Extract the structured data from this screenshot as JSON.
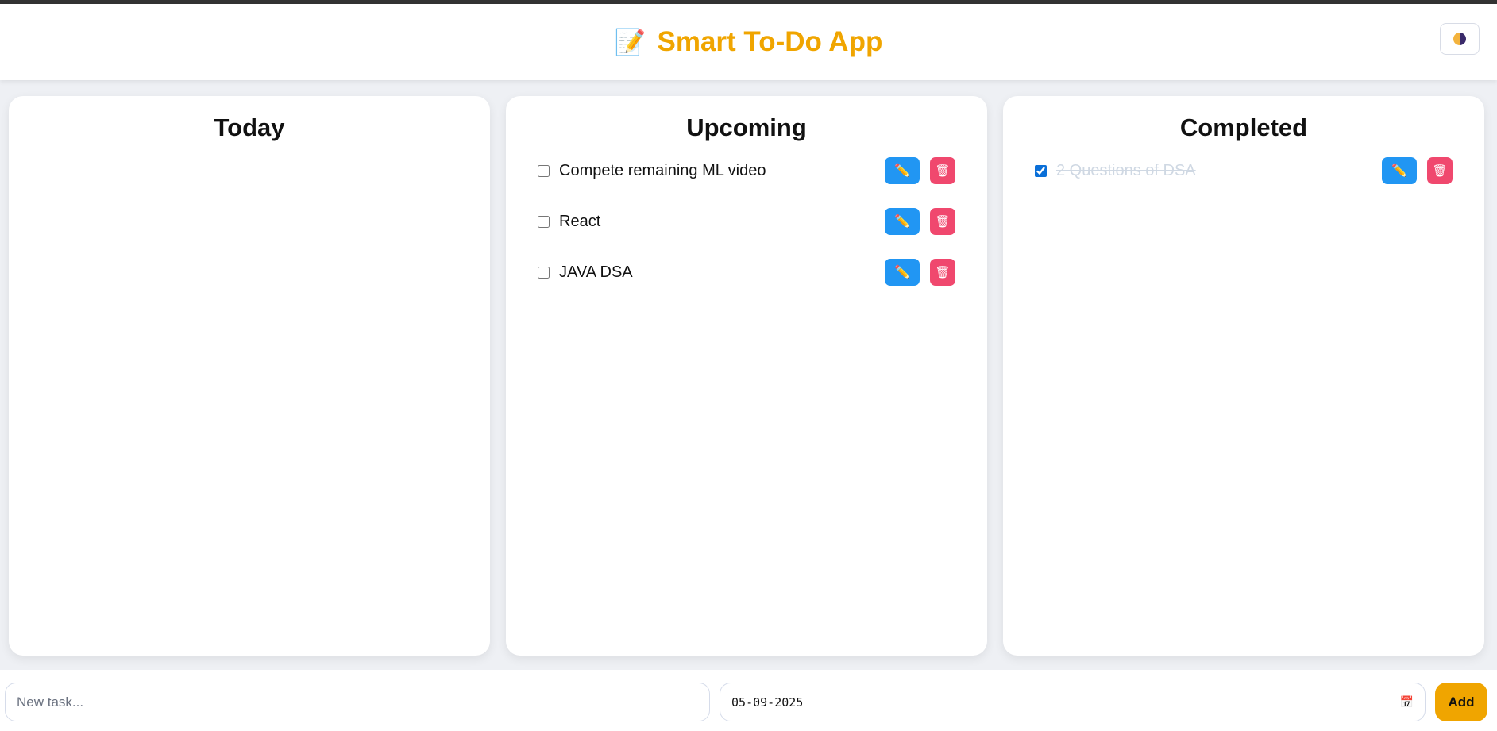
{
  "header": {
    "icon": "memo-icon",
    "title": "Smart To-Do App",
    "theme_toggle_icon": "half-moon-icon"
  },
  "columns": [
    {
      "title": "Today",
      "tasks": []
    },
    {
      "title": "Upcoming",
      "tasks": [
        {
          "text": "Compete remaining ML video",
          "done": false
        },
        {
          "text": "React",
          "done": false
        },
        {
          "text": "JAVA DSA",
          "done": false
        }
      ]
    },
    {
      "title": "Completed",
      "tasks": [
        {
          "text": "2 Questions of DSA",
          "done": true
        }
      ]
    }
  ],
  "form": {
    "task_placeholder": "New task...",
    "date_value": "05-09-2025",
    "add_label": "Add"
  },
  "colors": {
    "accent": "#f0a500",
    "edit": "#2196f3",
    "delete": "#f0486e"
  }
}
